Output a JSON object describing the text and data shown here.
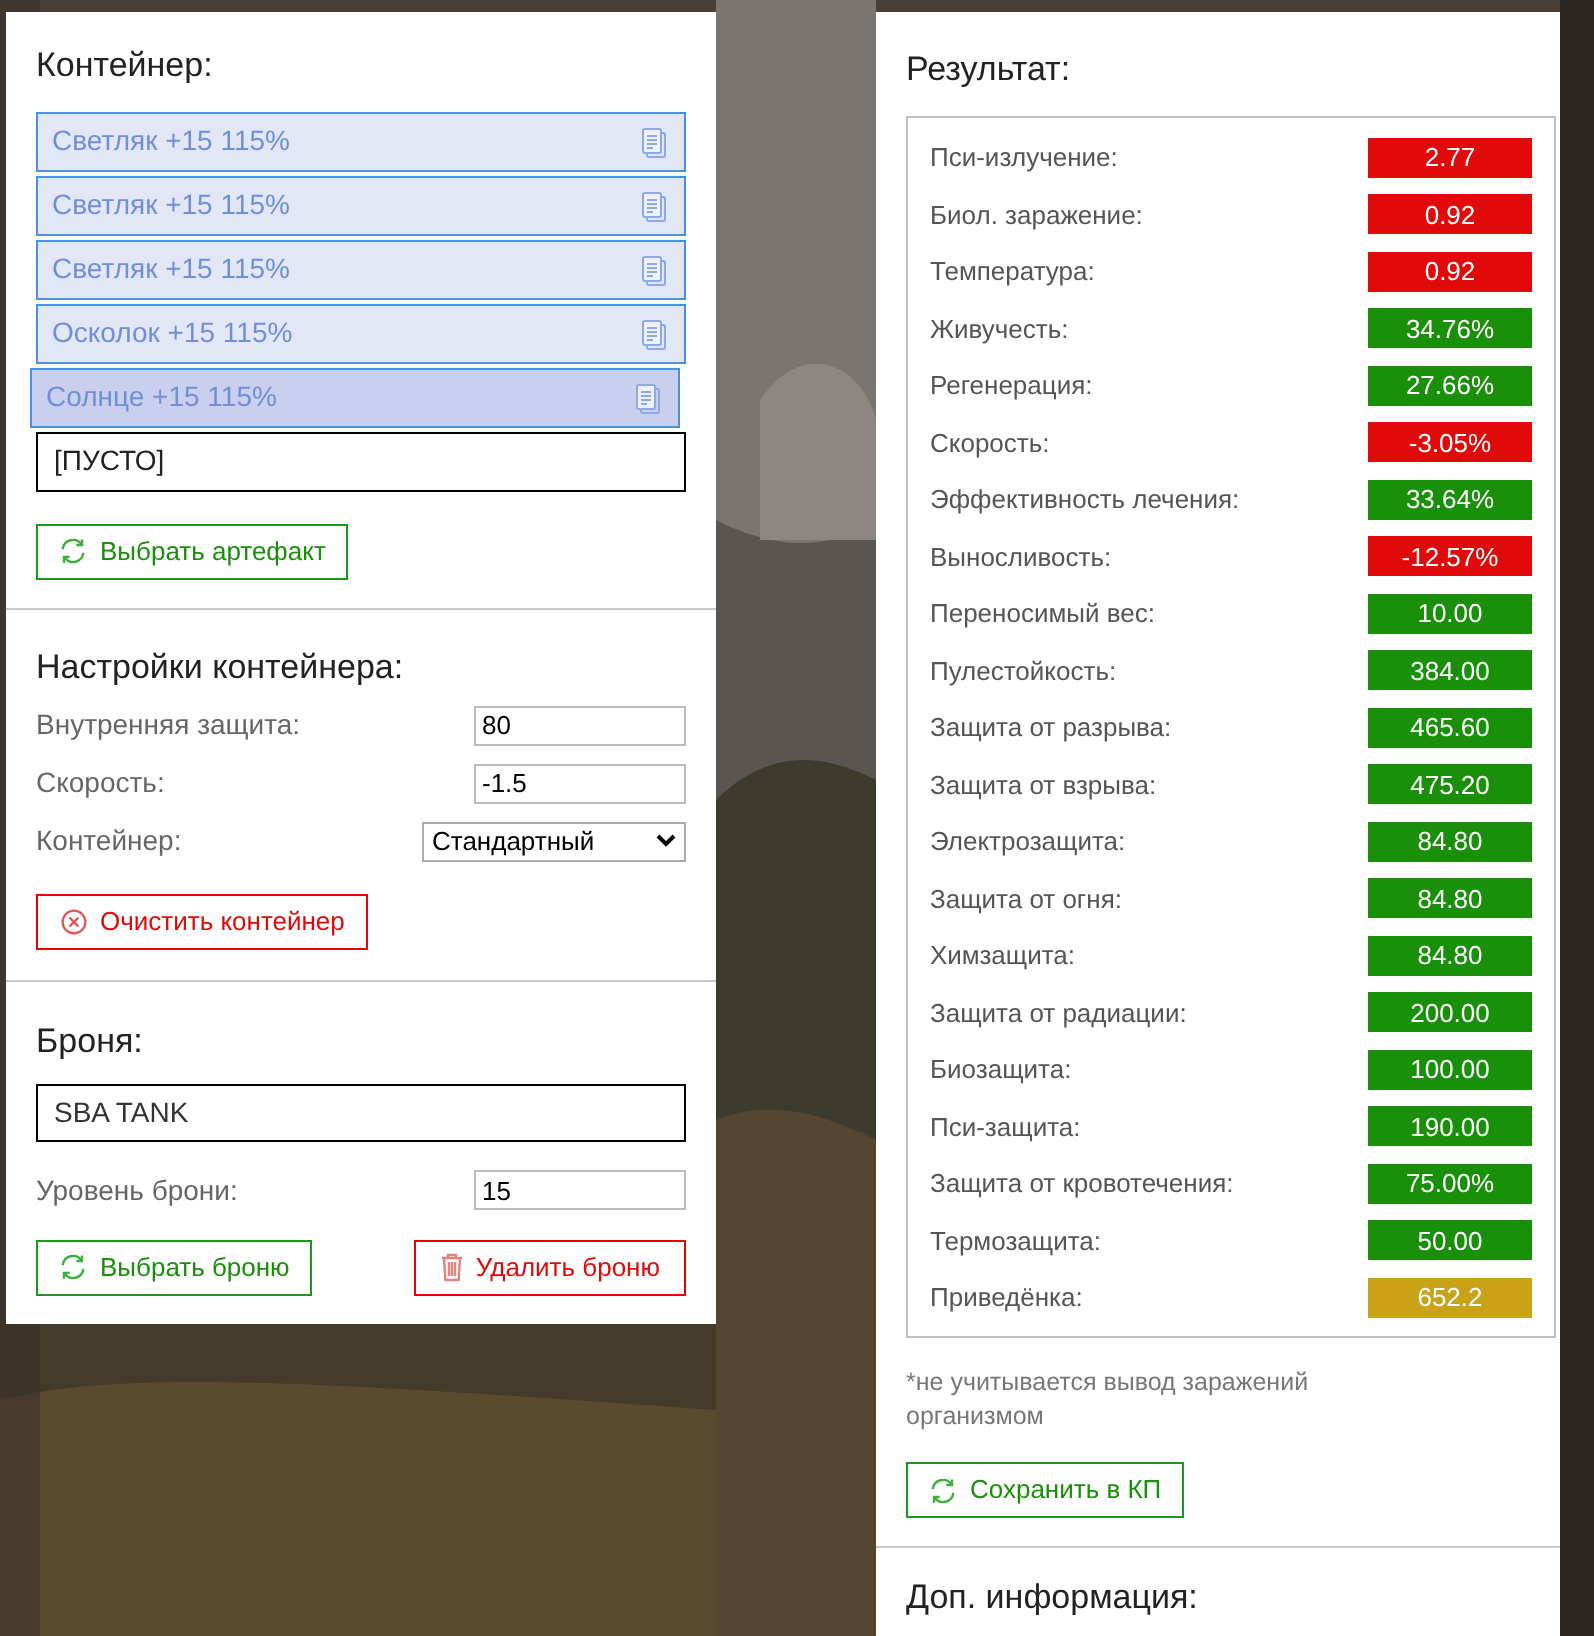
{
  "container": {
    "title": "Контейнер:",
    "slots": [
      {
        "kind": "artifact",
        "label": "Светляк +15 115%",
        "selected": false
      },
      {
        "kind": "artifact",
        "label": "Светляк +15 115%",
        "selected": false
      },
      {
        "kind": "artifact",
        "label": "Светляк +15 115%",
        "selected": false
      },
      {
        "kind": "artifact",
        "label": "Осколок +15 115%",
        "selected": false
      },
      {
        "kind": "artifact",
        "label": "Солнце +15 115%",
        "selected": true
      },
      {
        "kind": "empty",
        "label": "[ПУСТО]",
        "selected": false
      }
    ],
    "choose_button": "Выбрать артефакт"
  },
  "settings": {
    "title": "Настройки контейнера:",
    "fields": [
      {
        "kind": "input",
        "label": "Внутренняя защита:",
        "value": "80"
      },
      {
        "kind": "input",
        "label": "Скорость:",
        "value": "-1.5"
      },
      {
        "kind": "select",
        "label": "Контейнер:",
        "value": "Стандартный"
      }
    ],
    "clear_button": "Очистить контейнер"
  },
  "armor": {
    "title": "Броня:",
    "name": "SBA TANK",
    "level_label": "Уровень брони:",
    "level_value": "15",
    "choose_button": "Выбрать броню",
    "delete_button": "Удалить броню"
  },
  "result": {
    "title": "Результат:",
    "stats": [
      {
        "label": "Пси-излучение:",
        "value": "2.77",
        "color": "#e00a0a"
      },
      {
        "label": "Биол. заражение:",
        "value": "0.92",
        "color": "#e00a0a"
      },
      {
        "label": "Температура:",
        "value": "0.92",
        "color": "#e00a0a"
      },
      {
        "label": "Живучесть:",
        "value": "34.76%",
        "color": "#1a8f0a"
      },
      {
        "label": "Регенерация:",
        "value": "27.66%",
        "color": "#1a8f0a"
      },
      {
        "label": "Скорость:",
        "value": "-3.05%",
        "color": "#e00a0a"
      },
      {
        "label": "Эффективность лечения:",
        "value": "33.64%",
        "color": "#1a8f0a"
      },
      {
        "label": "Выносливость:",
        "value": "-12.57%",
        "color": "#e00a0a"
      },
      {
        "label": "Переносимый вес:",
        "value": "10.00",
        "color": "#1a8f0a"
      },
      {
        "label": "Пулестойкость:",
        "value": "384.00",
        "color": "#1a8f0a"
      },
      {
        "label": "Защита от разрыва:",
        "value": "465.60",
        "color": "#1a8f0a"
      },
      {
        "label": "Защита от взрыва:",
        "value": "475.20",
        "color": "#1a8f0a"
      },
      {
        "label": "Электрозащита:",
        "value": "84.80",
        "color": "#1a8f0a"
      },
      {
        "label": "Защита от огня:",
        "value": "84.80",
        "color": "#1a8f0a"
      },
      {
        "label": "Химзащита:",
        "value": "84.80",
        "color": "#1a8f0a"
      },
      {
        "label": "Защита от радиации:",
        "value": "200.00",
        "color": "#1a8f0a"
      },
      {
        "label": "Биозащита:",
        "value": "100.00",
        "color": "#1a8f0a"
      },
      {
        "label": "Пси-защита:",
        "value": "190.00",
        "color": "#1a8f0a"
      },
      {
        "label": "Защита от кровотечения:",
        "value": "75.00%",
        "color": "#1a8f0a"
      },
      {
        "label": "Термозащита:",
        "value": "50.00",
        "color": "#1a8f0a"
      },
      {
        "label": "Приведёнка:",
        "value": "652.2",
        "color": "#c9a218"
      }
    ],
    "note": "*не учитывается вывод заражений организмом",
    "save_button": "Сохранить в КП"
  },
  "extra": {
    "title": "Доп. информация:"
  }
}
